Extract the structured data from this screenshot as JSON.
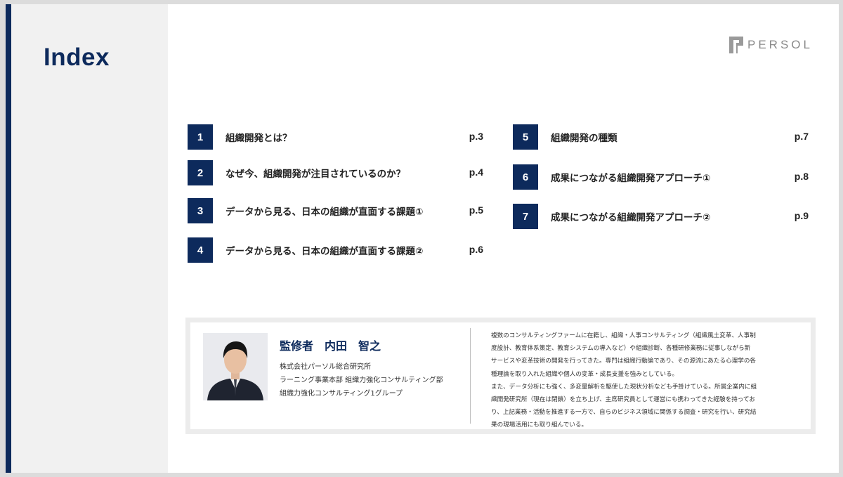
{
  "page": {
    "title": "Index"
  },
  "brand": {
    "logo_text": "PERSOL",
    "logo_icon": "persol-logo-icon"
  },
  "toc": [
    {
      "num": "1",
      "label": "組織開発とは？",
      "page": "p.3"
    },
    {
      "num": "2",
      "label": "なぜ今、組織開発が注目されているのか？",
      "page": "p.4"
    },
    {
      "num": "3",
      "label": "データから見る、日本の組織が直面する課題①",
      "page": "p.5"
    },
    {
      "num": "4",
      "label": "データから見る、日本の組織が直面する課題②",
      "page": "p.6"
    },
    {
      "num": "5",
      "label": "組織開発の種類",
      "page": "p.7"
    },
    {
      "num": "6",
      "label": "成果につながる組織開発アプローチ①",
      "page": "p.8"
    },
    {
      "num": "7",
      "label": "成果につながる組織開発アプローチ②",
      "page": "p.9"
    }
  ],
  "supervisor": {
    "title": "監修者　内田　智之",
    "affiliation": [
      "株式会社パーソル総合研究所",
      "ラーニング事業本部 組織力強化コンサルティング部",
      "組織力強化コンサルティング1グループ"
    ],
    "bio": [
      "複数のコンサルティングファームに在籍し、組織・人事コンサルティング（組織風土変革、人事制",
      "度設計、教育体系策定、教育システムの導入など）や組織診断、各種研修業務に従事しながら新",
      "サービスや変革技術の開発を行ってきた。専門は組織行動論であり、その源流にあたる心理学の各",
      "種理論を取り入れた組織や個人の変革・成長支援を強みとしている。",
      "また、データ分析にも強く、多変量解析を駆使した現状分析なども手掛けている。所属企業内に組",
      "織開発研究所（現在は閉鎖）を立ち上げ、主席研究員として運営にも携わってきた経験を持ってお",
      "り、上記業務・活動を推進する一方で、自らのビジネス領域に関係する調査・研究を行い、研究結",
      "果の現場活用にも取り組んでいる。"
    ]
  },
  "colors": {
    "navy": "#0d2a5c",
    "panel": "#f1f1f1",
    "logo_gray": "#8a8a8a"
  }
}
